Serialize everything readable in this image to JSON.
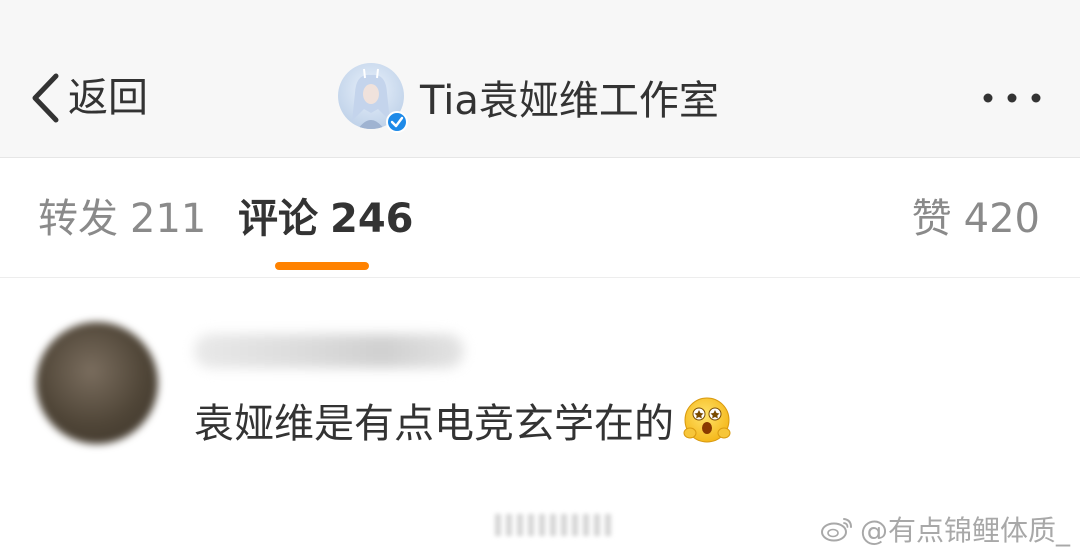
{
  "header": {
    "back_label": "返回",
    "account_name": "Tia袁娅维工作室",
    "more_label": "更多"
  },
  "tabs": [
    {
      "label": "转发",
      "count": "211"
    },
    {
      "label": "评论",
      "count": "246"
    },
    {
      "label": "赞",
      "count": "420"
    }
  ],
  "active_tab_index": 1,
  "comment": {
    "text": "袁娅维是有点电竞玄学在的",
    "emoji": "surprised-face-emoji"
  },
  "watermark": {
    "text": "@有点锦鲤体质_"
  },
  "colors": {
    "accent": "#ff8200",
    "header_bg": "#f7f7f7",
    "text_primary": "#333333",
    "text_secondary": "#8a8a8a",
    "verified": "#1e8ae8"
  }
}
